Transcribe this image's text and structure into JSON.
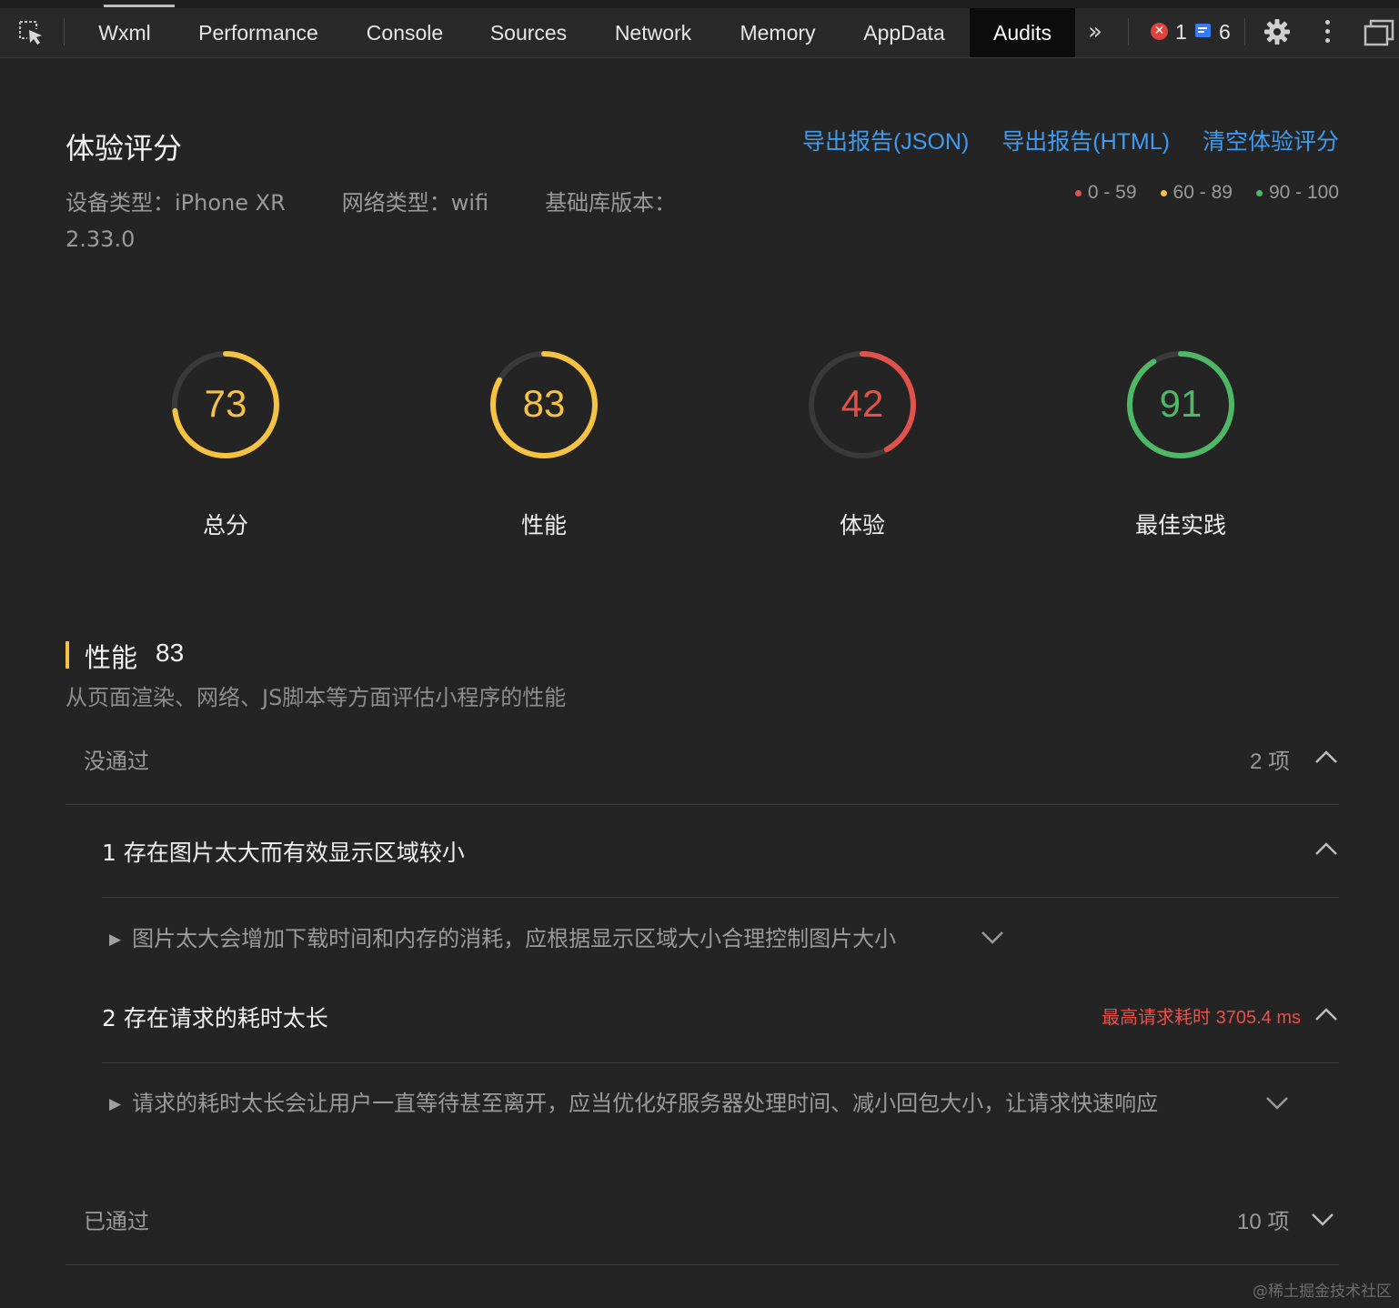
{
  "toolbar": {
    "tabs": [
      {
        "label": "Wxml"
      },
      {
        "label": "Performance"
      },
      {
        "label": "Console"
      },
      {
        "label": "Sources"
      },
      {
        "label": "Network"
      },
      {
        "label": "Memory"
      },
      {
        "label": "AppData"
      },
      {
        "label": "Audits"
      }
    ],
    "active_tab": "Audits",
    "more_label": "»",
    "error_count": "1",
    "message_count": "6"
  },
  "header": {
    "title": "体验评分",
    "actions": [
      "导出报告(JSON)",
      "导出报告(HTML)",
      "清空体验评分"
    ],
    "device": "设备类型：iPhone XR",
    "network": "网络类型：wifi",
    "lib_version": "基础库版本：2.33.0"
  },
  "legend": [
    {
      "label": "0 - 59",
      "color": "#e0524a"
    },
    {
      "label": "60 - 89",
      "color": "#f5c242"
    },
    {
      "label": "90 - 100",
      "color": "#4fb866"
    }
  ],
  "scores": [
    {
      "label": "总分",
      "value": 73,
      "color": "#f5c242"
    },
    {
      "label": "性能",
      "value": 83,
      "color": "#f5c242"
    },
    {
      "label": "体验",
      "value": 42,
      "color": "#e0524a"
    },
    {
      "label": "最佳实践",
      "value": 91,
      "color": "#4fb866"
    }
  ],
  "section": {
    "title": "性能",
    "score": "83",
    "description": "从页面渲染、网络、JS脚本等方面评估小程序的性能",
    "failed_label": "没通过",
    "failed_count": "2 项",
    "items": [
      {
        "title": "1 存在图片太大而有效显示区域较小",
        "description": "图片太大会增加下载时间和内存的消耗，应根据显示区域大小合理控制图片大小"
      },
      {
        "title": "2 存在请求的耗时太长",
        "warning": "最高请求耗时 3705.4 ms",
        "description": "请求的耗时太长会让用户一直等待甚至离开，应当优化好服务器处理时间、减小回包大小，让请求快速响应"
      }
    ],
    "passed_label": "已通过",
    "passed_count": "10 项"
  },
  "watermark": "@稀土掘金技术社区"
}
